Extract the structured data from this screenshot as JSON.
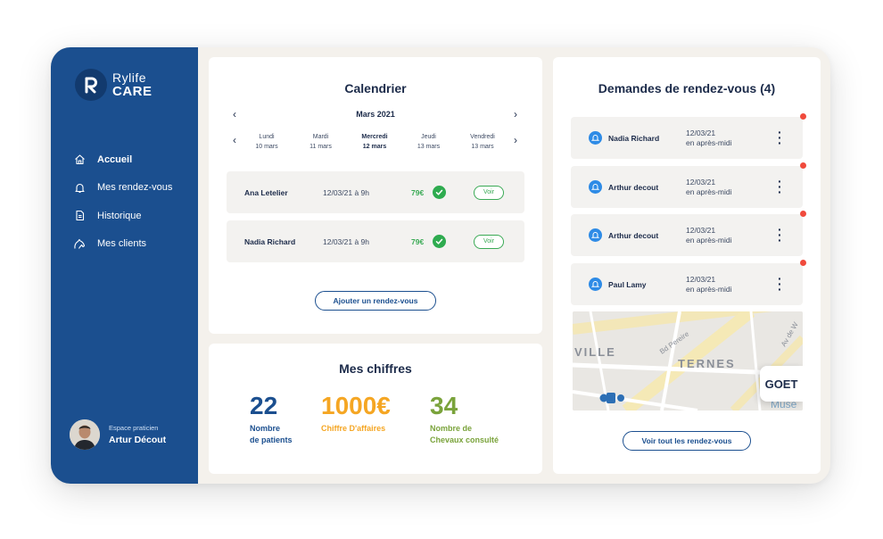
{
  "brand": {
    "line1": "Rylife",
    "line2": "CARE",
    "color": "#1b4f8f"
  },
  "sidebar": {
    "items": [
      {
        "label": "Accueil",
        "icon": "home-icon",
        "active": true
      },
      {
        "label": "Mes rendez-vous",
        "icon": "bell-icon",
        "active": false
      },
      {
        "label": "Historique",
        "icon": "document-icon",
        "active": false
      },
      {
        "label": "Mes clients",
        "icon": "horse-icon",
        "active": false
      }
    ],
    "user": {
      "role": "Espace praticien",
      "name": "Artur Décout"
    }
  },
  "calendar": {
    "title": "Calendrier",
    "month": "Mars 2021",
    "days": [
      {
        "name": "Lundi",
        "date": "10 mars"
      },
      {
        "name": "Mardi",
        "date": "11 mars"
      },
      {
        "name": "Mercredi",
        "date": "12 mars",
        "selected": true
      },
      {
        "name": "Jeudi",
        "date": "13 mars"
      },
      {
        "name": "Vendredi",
        "date": "13 mars"
      }
    ],
    "appointments": [
      {
        "name": "Ana Letelier",
        "datetime": "12/03/21 à 9h",
        "price": "79€",
        "action": "Voir"
      },
      {
        "name": "Nadia Richard",
        "datetime": "12/03/21 à 9h",
        "price": "79€",
        "action": "Voir"
      }
    ],
    "add_button": "Ajouter un rendez-vous"
  },
  "stats": {
    "title": "Mes chiffres",
    "items": [
      {
        "value": "22",
        "line1": "Nombre",
        "line2": "de patients",
        "color": "#1b4f8f"
      },
      {
        "value": "1000€",
        "line1": "Chiffre D'affaires",
        "line2": "",
        "color": "#f5a623"
      },
      {
        "value": "34",
        "line1": "Nombre de",
        "line2": "Chevaux consulté",
        "color": "#7aa33b"
      }
    ]
  },
  "requests": {
    "title": "Demandes de rendez-vous (4)",
    "items": [
      {
        "name": "Nadia Richard",
        "date": "12/03/21",
        "period": "en après-midi"
      },
      {
        "name": "Arthur decout",
        "date": "12/03/21",
        "period": "en après-midi"
      },
      {
        "name": "Arthur decout",
        "date": "12/03/21",
        "period": "en après-midi"
      },
      {
        "name": "Paul Lamy",
        "date": "12/03/21",
        "period": "en après-midi"
      }
    ],
    "map": {
      "labels": [
        "VILLE",
        "TERNES",
        "Bd Pereire",
        "Av de W",
        "Muse"
      ],
      "place": "GOET"
    },
    "view_all": "Voir tout les rendez-vous"
  }
}
